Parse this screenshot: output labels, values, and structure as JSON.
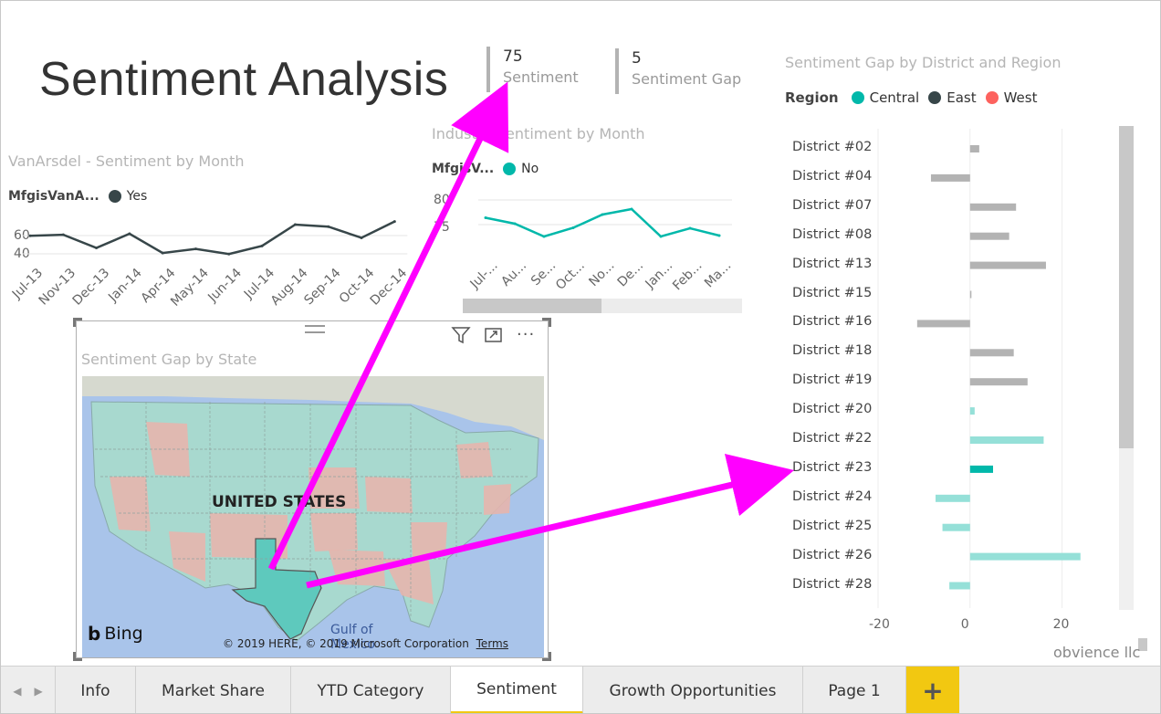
{
  "header": {
    "title": "Sentiment Analysis"
  },
  "kpis": [
    {
      "value": "75",
      "label": "Sentiment"
    },
    {
      "value": "5",
      "label": "Sentiment Gap"
    }
  ],
  "vanarsdel_chart": {
    "title": "VanArsdel - Sentiment by Month",
    "legend_field": "MfgisVanA...",
    "legend_item": "Yes",
    "y_ticks": [
      "60",
      "40"
    ],
    "x_ticks": [
      "Jul-13",
      "Nov-13",
      "Dec-13",
      "Jan-14",
      "Apr-14",
      "May-14",
      "Jun-14",
      "Jul-14",
      "Aug-14",
      "Sep-14",
      "Oct-14",
      "Dec-14"
    ],
    "line_color": "#374649"
  },
  "industry_chart": {
    "title": "Industry Sentiment by Month",
    "legend_field": "MfgisV...",
    "legend_item": "No",
    "y_ticks": [
      "80",
      "75"
    ],
    "x_ticks": [
      "Jul-...",
      "Au...",
      "Se...",
      "Oct...",
      "No...",
      "De...",
      "Jan...",
      "Feb...",
      "Ma..."
    ],
    "line_color": "#01b8aa"
  },
  "map_visual": {
    "title": "Sentiment Gap by State",
    "country_label": "UNITED STATES",
    "water_label": "Gulf of Mexico",
    "bing_label": "Bing",
    "copyright": "© 2019 HERE, © 2019 Microsoft Corporation",
    "terms": "Terms",
    "filter_icon": "filter-icon",
    "focus_icon": "focus-mode-icon",
    "more_icon": "more-options-icon"
  },
  "district_chart": {
    "title": "Sentiment Gap by District and Region",
    "legend_label": "Region",
    "regions": [
      {
        "name": "Central",
        "color": "#01b8aa"
      },
      {
        "name": "East",
        "color": "#374649"
      },
      {
        "name": "West",
        "color": "#fd625e"
      }
    ],
    "x_ticks": [
      "-20",
      "0",
      "20"
    ]
  },
  "chart_data": [
    {
      "type": "line",
      "title": "VanArsdel - Sentiment by Month",
      "categories": [
        "Jul-13",
        "Nov-13",
        "Dec-13",
        "Jan-14",
        "Apr-14",
        "May-14",
        "Jun-14",
        "Jul-14",
        "Aug-14",
        "Sep-14",
        "Oct-14",
        "Dec-14"
      ],
      "series": [
        {
          "name": "Yes",
          "values": [
            55,
            56,
            43,
            57,
            38,
            42,
            37,
            45,
            66,
            64,
            53,
            69
          ]
        }
      ],
      "ylim": [
        30,
        75
      ]
    },
    {
      "type": "line",
      "title": "Industry Sentiment by Month",
      "categories": [
        "Jul-...",
        "Au...",
        "Se...",
        "Oct...",
        "No...",
        "De...",
        "Jan...",
        "Feb...",
        "Ma..."
      ],
      "series": [
        {
          "name": "No",
          "values": [
            76.5,
            75.2,
            72.4,
            74.3,
            77.2,
            78.4,
            72.4,
            74.2,
            72.6
          ]
        }
      ],
      "ylim": [
        68,
        82
      ]
    },
    {
      "type": "bar",
      "orientation": "horizontal",
      "title": "Sentiment Gap by District and Region",
      "categories": [
        "District #02",
        "District #04",
        "District #07",
        "District #08",
        "District #13",
        "District #15",
        "District #16",
        "District #18",
        "District #19",
        "District #20",
        "District #22",
        "District #23",
        "District #24",
        "District #25",
        "District #26",
        "District #28"
      ],
      "values": [
        2,
        -8.5,
        10,
        8.5,
        16.5,
        0.3,
        -11.5,
        9.5,
        12.5,
        1,
        16,
        5,
        -7.5,
        -6,
        24,
        -4.5
      ],
      "highlight": [
        false,
        false,
        false,
        false,
        false,
        false,
        false,
        false,
        false,
        true,
        true,
        true,
        true,
        true,
        true,
        true
      ],
      "xlim": [
        -20,
        30
      ]
    }
  ],
  "tabs": {
    "items": [
      "Info",
      "Market Share",
      "YTD Category",
      "Sentiment",
      "Growth Opportunities",
      "Page 1"
    ],
    "active": "Sentiment",
    "add_label": "+"
  },
  "footer": {
    "watermark": "obvience llc"
  }
}
